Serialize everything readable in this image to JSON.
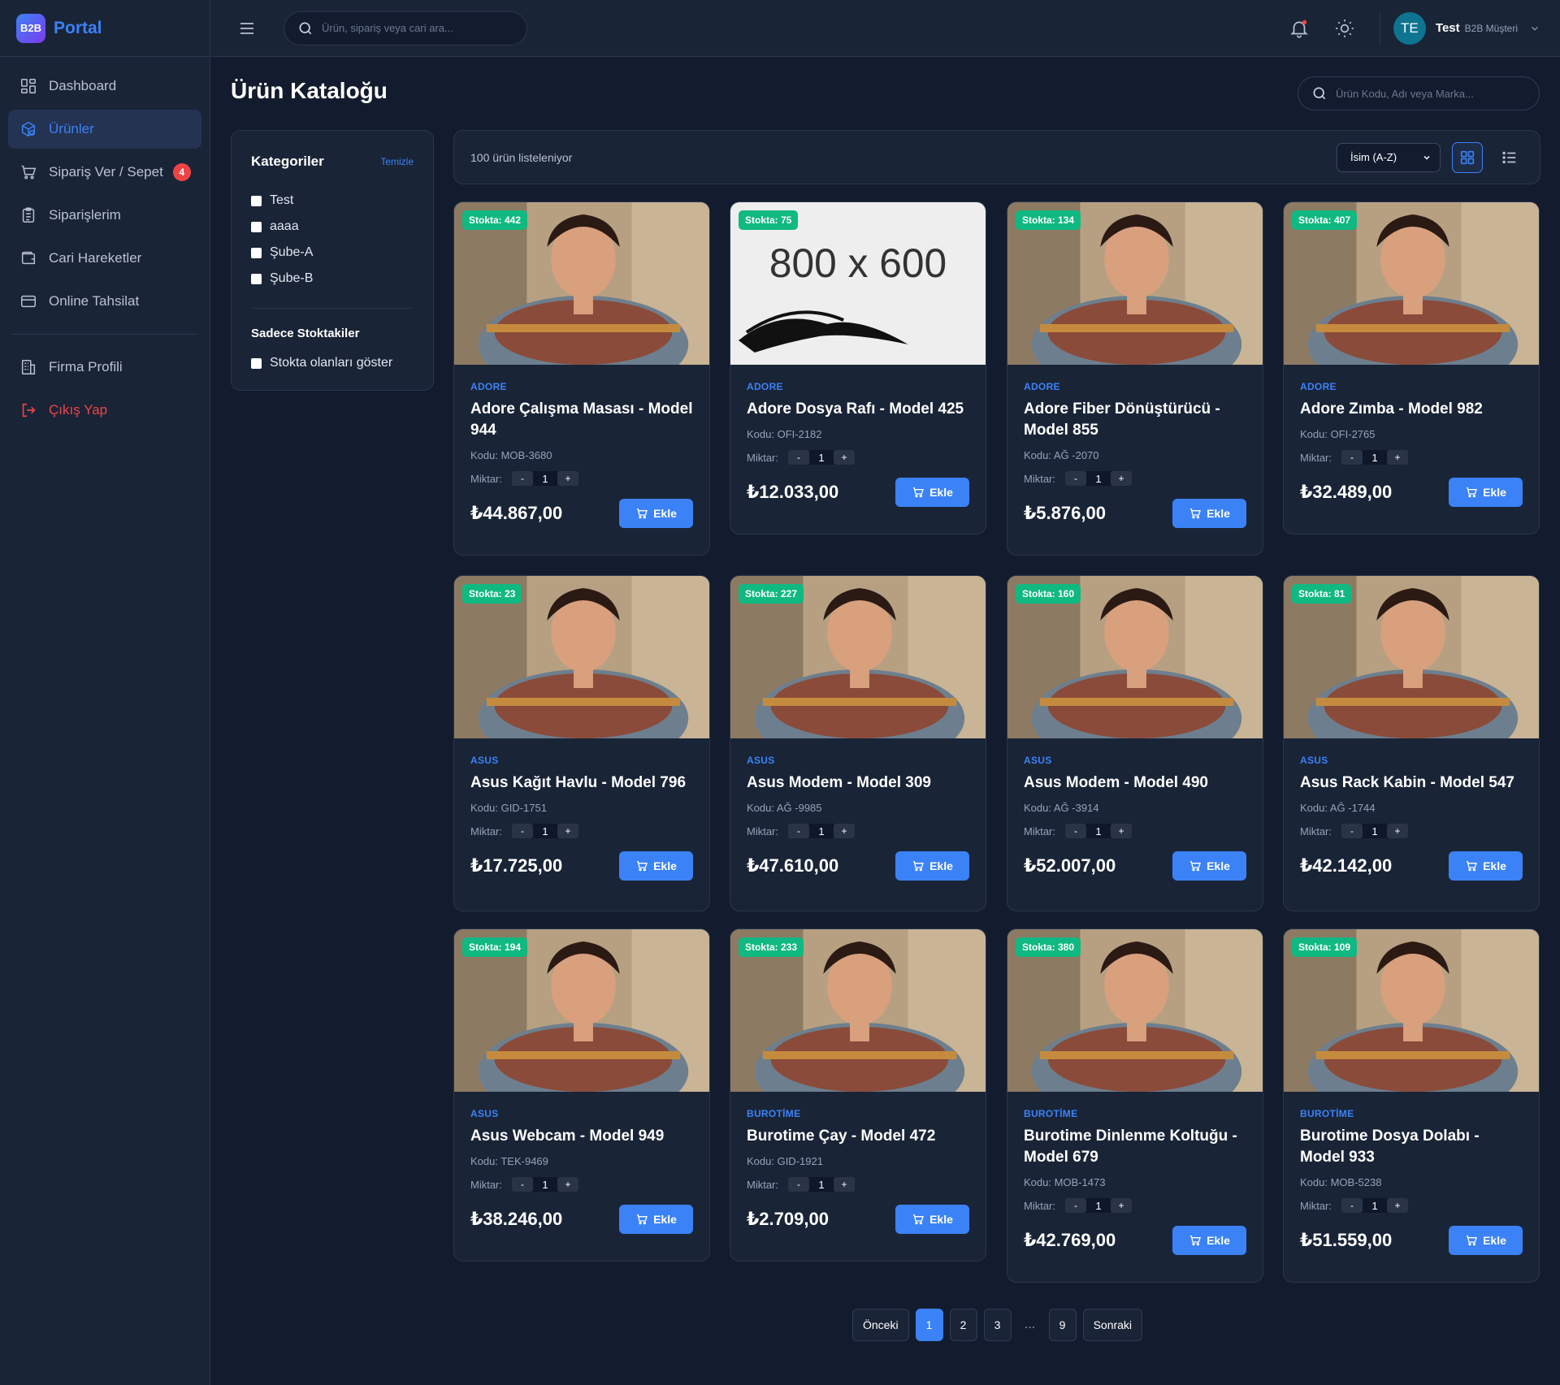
{
  "brand": {
    "logo_text": "B2B",
    "name": "Portal"
  },
  "sidebar": {
    "items": [
      {
        "label": "Dashboard",
        "icon": "grid-icon"
      },
      {
        "label": "Ürünler",
        "icon": "box-icon",
        "active": true
      },
      {
        "label": "Sipariş Ver / Sepet",
        "icon": "cart-icon",
        "badge": "4"
      },
      {
        "label": "Siparişlerim",
        "icon": "clipboard-icon"
      },
      {
        "label": "Cari Hareketler",
        "icon": "wallet-icon"
      },
      {
        "label": "Online Tahsilat",
        "icon": "credit-card-icon"
      }
    ],
    "secondary": [
      {
        "label": "Firma Profili",
        "icon": "building-icon"
      },
      {
        "label": "Çıkış Yap",
        "icon": "logout-icon"
      }
    ]
  },
  "topbar": {
    "search_placeholder": "Ürün, sipariş veya cari ara...",
    "user": {
      "initials": "TE",
      "name": "Test",
      "role": "B2B Müşteri"
    }
  },
  "page": {
    "title": "Ürün Kataloğu",
    "search_placeholder": "Ürün Kodu, Adı veya Marka..."
  },
  "filters": {
    "title": "Kategoriler",
    "clear_label": "Temizle",
    "categories": [
      "Test",
      "aaaa",
      "Şube-A",
      "Şube-B"
    ],
    "stock_title": "Sadece Stoktakiler",
    "stock_label": "Stokta olanları göster"
  },
  "toolbar": {
    "count_text": "100 ürün listeleniyor",
    "sort_value": "İsim (A-Z)"
  },
  "card_labels": {
    "qty_label": "Miktar:",
    "qty_value": "1",
    "add_label": "Ekle",
    "code_prefix": "Kodu: "
  },
  "placeholder_image_text": "800 x 600",
  "products": [
    {
      "stock": "Stokta: 442",
      "brand": "ADORE",
      "name": "Adore Çalışma Masası - Model 944",
      "code": "Kodu: MOB-3680",
      "price": "₺44.867,00",
      "image": "photo"
    },
    {
      "stock": "Stokta: 75",
      "brand": "ADORE",
      "name": "Adore Dosya Rafı - Model 425",
      "code": "Kodu: OFI-2182",
      "price": "₺12.033,00",
      "image": "placeholder"
    },
    {
      "stock": "Stokta: 134",
      "brand": "ADORE",
      "name": "Adore Fiber Dönüştürücü - Model 855",
      "code": "Kodu: AĞ -2070",
      "price": "₺5.876,00",
      "image": "photo"
    },
    {
      "stock": "Stokta: 407",
      "brand": "ADORE",
      "name": "Adore Zımba - Model 982",
      "code": "Kodu: OFI-2765",
      "price": "₺32.489,00",
      "image": "photo"
    },
    {
      "stock": "Stokta: 23",
      "brand": "ASUS",
      "name": "Asus Kağıt Havlu - Model 796",
      "code": "Kodu: GID-1751",
      "price": "₺17.725,00",
      "image": "photo"
    },
    {
      "stock": "Stokta: 227",
      "brand": "ASUS",
      "name": "Asus Modem - Model 309",
      "code": "Kodu: AĞ -9985",
      "price": "₺47.610,00",
      "image": "photo"
    },
    {
      "stock": "Stokta: 160",
      "brand": "ASUS",
      "name": "Asus Modem - Model 490",
      "code": "Kodu: AĞ -3914",
      "price": "₺52.007,00",
      "image": "photo"
    },
    {
      "stock": "Stokta: 81",
      "brand": "ASUS",
      "name": "Asus Rack Kabin - Model 547",
      "code": "Kodu: AĞ -1744",
      "price": "₺42.142,00",
      "image": "photo"
    },
    {
      "stock": "Stokta: 194",
      "brand": "ASUS",
      "name": "Asus Webcam - Model 949",
      "code": "Kodu: TEK-9469",
      "price": "₺38.246,00",
      "image": "photo"
    },
    {
      "stock": "Stokta: 233",
      "brand": "BUROTİME",
      "name": "Burotime Çay - Model 472",
      "code": "Kodu: GID-1921",
      "price": "₺2.709,00",
      "image": "photo"
    },
    {
      "stock": "Stokta: 380",
      "brand": "BUROTİME",
      "name": "Burotime Dinlenme Koltuğu - Model 679",
      "code": "Kodu: MOB-1473",
      "price": "₺42.769,00",
      "image": "photo"
    },
    {
      "stock": "Stokta: 109",
      "brand": "BUROTİME",
      "name": "Burotime Dosya Dolabı - Model 933",
      "code": "Kodu: MOB-5238",
      "price": "₺51.559,00",
      "image": "photo"
    }
  ],
  "pagination": {
    "prev": "Önceki",
    "pages": [
      "1",
      "2",
      "3"
    ],
    "dots": "...",
    "last": "9",
    "next": "Sonraki",
    "current": "1"
  },
  "colors": {
    "accent": "#3b82f6",
    "stock_badge": "#10b981",
    "danger": "#ef4444",
    "background": "#131c2e",
    "panel": "#1a2437"
  }
}
